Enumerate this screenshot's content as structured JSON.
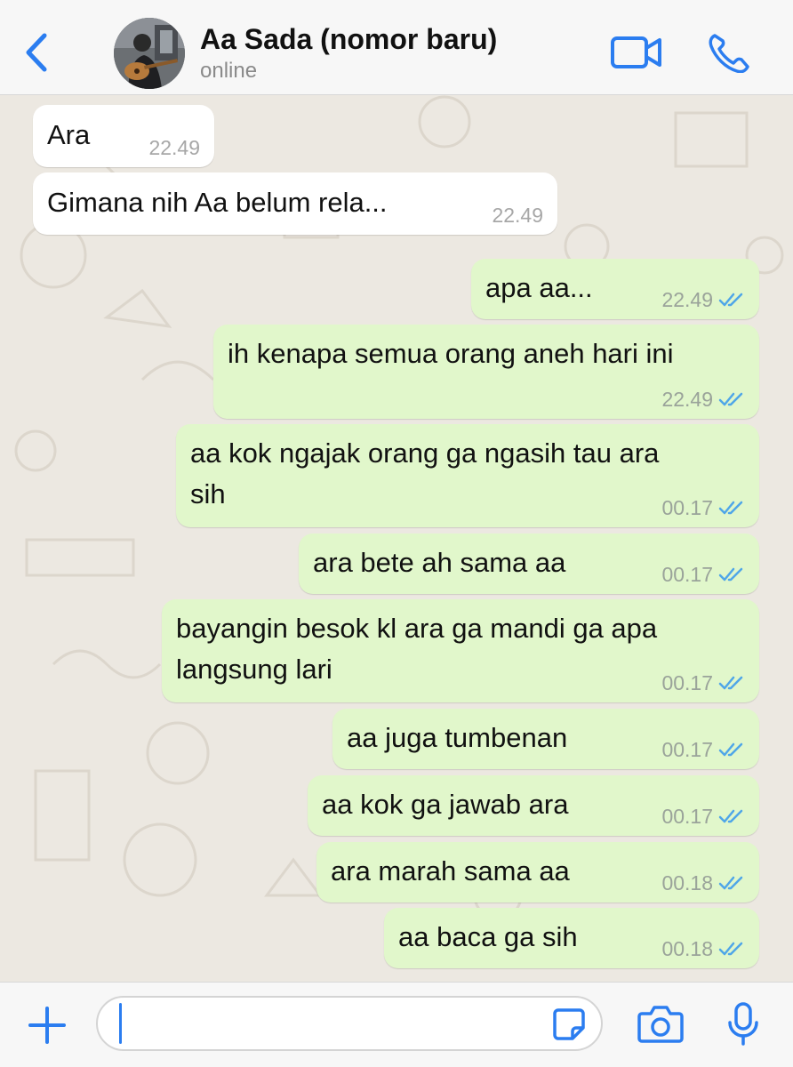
{
  "header": {
    "back_icon": "chevron-left-icon",
    "contact_name": "Aa Sada (nomor baru)",
    "status": "online",
    "video_icon": "video-camera-icon",
    "call_icon": "phone-icon"
  },
  "messages": [
    {
      "direction": "incoming",
      "text": "Ara",
      "time": "22.49"
    },
    {
      "direction": "incoming",
      "text": "Gimana nih Aa belum rela...",
      "time": "22.49"
    },
    {
      "direction": "outgoing",
      "text": "apa aa...",
      "time": "22.49",
      "status": "read"
    },
    {
      "direction": "outgoing",
      "text": "ih kenapa semua orang aneh hari ini",
      "time": "22.49",
      "status": "read"
    },
    {
      "direction": "outgoing",
      "text_line1": "aa kok ngajak orang ga ngasih tau ara",
      "text_line2": "sih",
      "time": "00.17",
      "status": "read"
    },
    {
      "direction": "outgoing",
      "text": "ara bete ah sama aa",
      "time": "00.17",
      "status": "read"
    },
    {
      "direction": "outgoing",
      "text_line1": "bayangin besok kl ara ga mandi ga apa",
      "text_line2": "langsung lari",
      "time": "00.17",
      "status": "read"
    },
    {
      "direction": "outgoing",
      "text": "aa juga tumbenan",
      "time": "00.17",
      "status": "read"
    },
    {
      "direction": "outgoing",
      "text": "aa kok ga jawab ara",
      "time": "00.17",
      "status": "read"
    },
    {
      "direction": "outgoing",
      "text": "ara marah sama aa",
      "time": "00.18",
      "status": "read"
    },
    {
      "direction": "outgoing",
      "text": "aa baca ga sih",
      "time": "00.18",
      "status": "read"
    }
  ],
  "input_bar": {
    "plus_icon": "plus-icon",
    "message_value": "",
    "sticker_icon": "sticker-icon",
    "camera_icon": "camera-icon",
    "mic_icon": "microphone-icon"
  },
  "colors": {
    "accent": "#2b7df0",
    "incoming_bubble": "#ffffff",
    "outgoing_bubble": "#e1f7cb",
    "read_tick": "#4fa6e8",
    "wallpaper": "#ece8e1"
  }
}
